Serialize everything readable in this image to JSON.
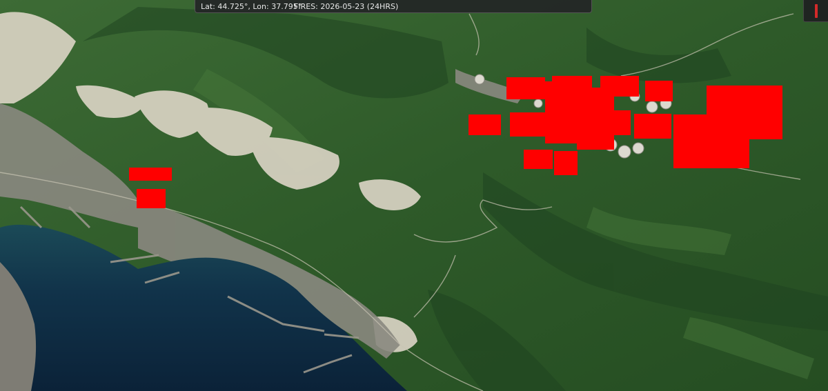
{
  "status": {
    "coordinates": "Lat: 44.725°, Lon: 37.795°",
    "fires": "FIRES: 2026-05-23 (24HRS)"
  },
  "map": {
    "type": "satellite",
    "colors": {
      "fire_marker": "#ff0000",
      "water": "#0f2f45",
      "forest": "#2f5a2a",
      "quarry": "#d8d2c2",
      "urban": "#8c8a82"
    }
  },
  "controls": {
    "close_icon": "close-icon",
    "close_color": "#d42a2a"
  }
}
